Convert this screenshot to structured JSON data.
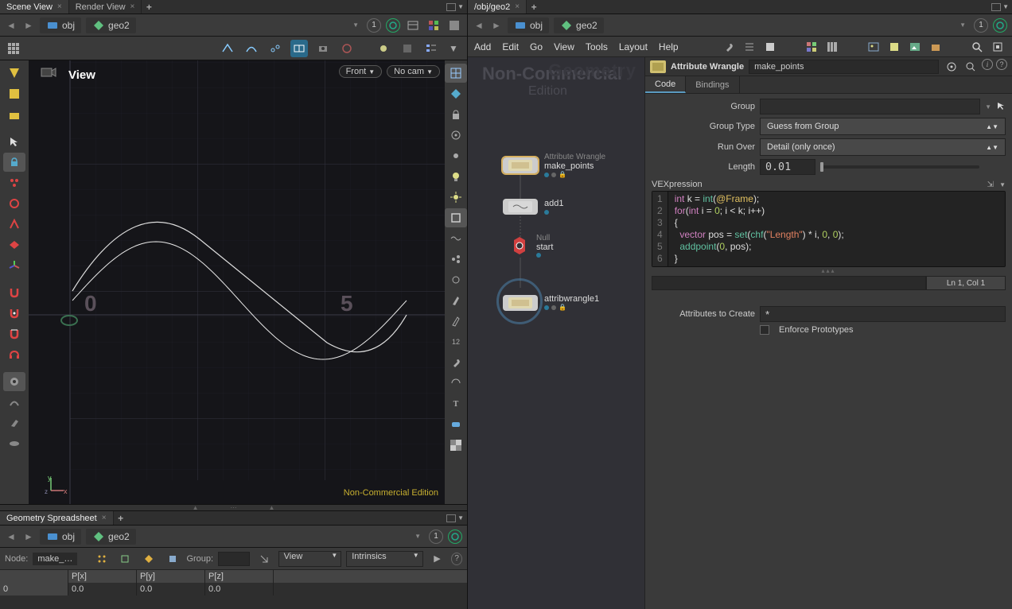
{
  "left": {
    "tabs": [
      "Scene View",
      "Render View"
    ],
    "active_tab": 0,
    "path": {
      "root": "obj",
      "node": "geo2",
      "pin": "1"
    },
    "viewport": {
      "title": "View",
      "front_dd": "Front",
      "cam_dd": "No cam",
      "watermark": "Non-Commercial Edition",
      "origin_label": "0",
      "five_label": "5",
      "axis_y": "y",
      "axis_x": "x"
    }
  },
  "spreadsheet": {
    "tab": "Geometry Spreadsheet",
    "path": {
      "root": "obj",
      "node": "geo2",
      "pin": "1"
    },
    "node_label": "Node:",
    "node_name": "make_…",
    "group_label": "Group:",
    "view_dd": "View",
    "intrinsics_dd": "Intrinsics",
    "columns": [
      "",
      "P[x]",
      "P[y]",
      "P[z]"
    ],
    "rows": [
      [
        "0",
        "0.0",
        "0.0",
        "0.0"
      ]
    ]
  },
  "right": {
    "tab": "/obj/geo2",
    "path": {
      "root": "obj",
      "node": "geo2",
      "pin": "1"
    },
    "menu": [
      "Add",
      "Edit",
      "Go",
      "View",
      "Tools",
      "Layout",
      "Help"
    ],
    "network": {
      "title": "Non-Commercial",
      "subtitle": "Edition",
      "bg_label": "Geometry",
      "nodes": [
        {
          "type": "Attribute Wrangle",
          "name": "make_points",
          "selected": true,
          "flags": [
            "disp",
            "tpl",
            "lock"
          ]
        },
        {
          "type": "",
          "name": "add1",
          "flags": [
            "disp"
          ]
        },
        {
          "type": "Null",
          "name": "start",
          "null": true,
          "flags": [
            "disp"
          ]
        },
        {
          "type": "",
          "name": "attribwrangle1",
          "ring": true,
          "flags": [
            "disp",
            "tpl",
            "lock"
          ]
        }
      ]
    },
    "parm": {
      "op_type": "Attribute Wrangle",
      "op_name": "make_points",
      "tabs": [
        "Code",
        "Bindings"
      ],
      "active_tab": 0,
      "group_label": "Group",
      "group_value": "",
      "grouptype_label": "Group Type",
      "grouptype_value": "Guess from Group",
      "runover_label": "Run Over",
      "runover_value": "Detail (only once)",
      "length_label": "Length",
      "length_value": "0.01",
      "vex_label": "VEXpression",
      "status": "Ln 1, Col 1",
      "attrs_label": "Attributes to Create",
      "attrs_value": "*",
      "enforce_label": "Enforce Prototypes",
      "code_lines": [
        "int k = int(@Frame);",
        "for(int i = 0; i < k; i++)",
        "{",
        "  vector pos = set(chf(\"Length\") * i, 0, 0);",
        "  addpoint(0, pos);",
        "}"
      ]
    }
  }
}
